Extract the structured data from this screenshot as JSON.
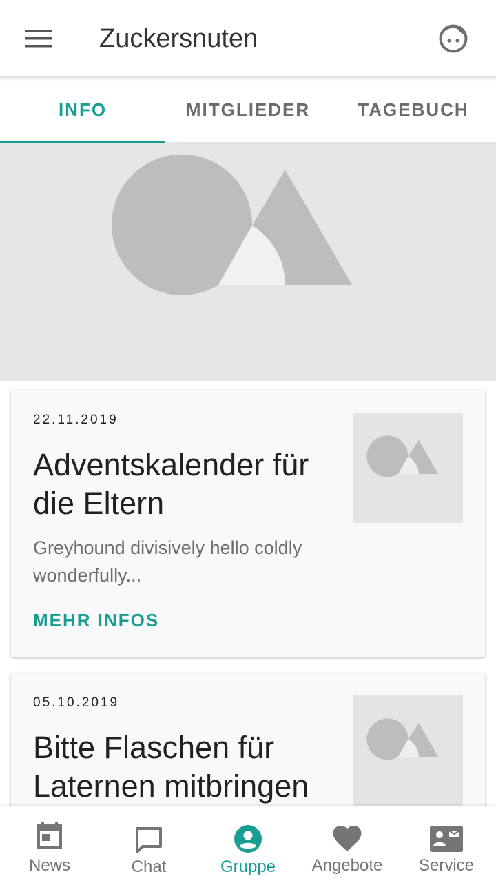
{
  "app_bar": {
    "title": "Zuckersnuten",
    "menu_icon": "menu-icon",
    "profile_icon": "face-icon"
  },
  "tabs": [
    {
      "label": "INFO",
      "active": true
    },
    {
      "label": "MITGLIEDER",
      "active": false
    },
    {
      "label": "TAGEBUCH",
      "active": false
    }
  ],
  "hero": {
    "icon": "image-placeholder-icon"
  },
  "posts": [
    {
      "date": "22.11.2019",
      "title": "Adventskalender für die Eltern",
      "excerpt": "Greyhound divisively hello coldly wonderfully...",
      "link": "MEHR INFOS",
      "thumbnail_icon": "image-placeholder-icon"
    },
    {
      "date": "05.10.2019",
      "title": "Bitte Flaschen für Laternen mitbringen",
      "thumbnail_icon": "image-placeholder-icon"
    }
  ],
  "bottom_nav": [
    {
      "label": "News",
      "icon": "calendar-icon",
      "active": false
    },
    {
      "label": "Chat",
      "icon": "chat-icon",
      "active": false
    },
    {
      "label": "Gruppe",
      "icon": "account-circle-icon",
      "active": true
    },
    {
      "label": "Angebote",
      "icon": "heart-icon",
      "active": false
    },
    {
      "label": "Service",
      "icon": "contact-mail-icon",
      "active": false
    }
  ],
  "colors": {
    "accent": "#1a9e94",
    "inactive": "#757575",
    "placeholder_bg": "#e6e6e6",
    "placeholder_shape": "#bdbdbd"
  }
}
